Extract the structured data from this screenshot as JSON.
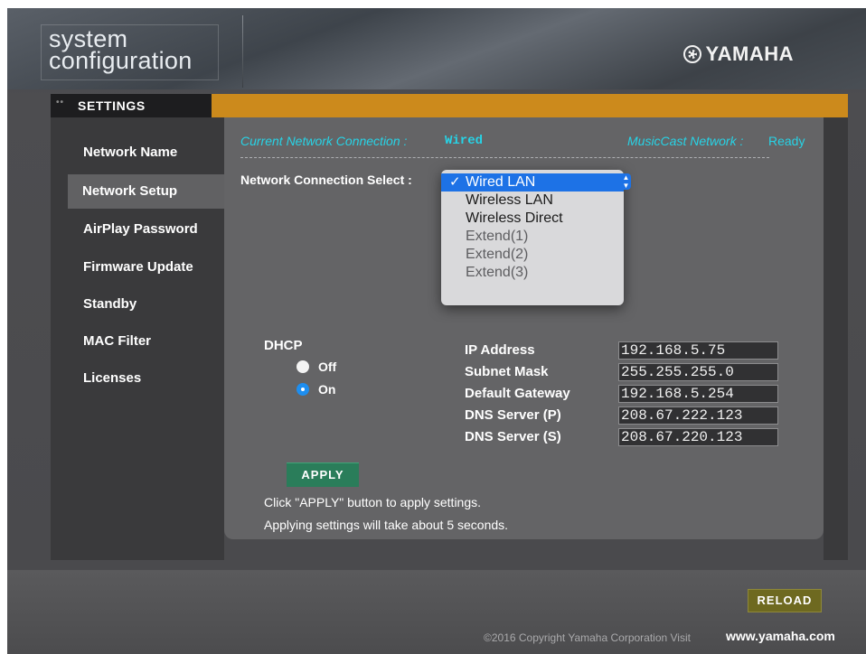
{
  "header": {
    "logo_line1": "system",
    "logo_line2": "configuration",
    "brand": "YAMAHA",
    "brand_icon": "tuning-fork-emblem-icon"
  },
  "settings_tab": {
    "dots": "••",
    "label": "SETTINGS"
  },
  "sidebar": {
    "items": [
      {
        "label": "Network Name",
        "active": false
      },
      {
        "label": "Network Setup",
        "active": true
      },
      {
        "label": "AirPlay Password",
        "active": false
      },
      {
        "label": "Firmware Update",
        "active": false
      },
      {
        "label": "Standby",
        "active": false
      },
      {
        "label": "MAC Filter",
        "active": false
      },
      {
        "label": "Licenses",
        "active": false
      }
    ]
  },
  "status": {
    "current_connection_label": "Current Network Connection :",
    "current_connection_value": "Wired",
    "musiccast_label": "MusicCast Network :",
    "musiccast_value": "Ready",
    "accent_color": "#27d3e6"
  },
  "connection_select": {
    "label": "Network Connection Select :",
    "selected": "Wired LAN",
    "options": [
      {
        "label": "Wired LAN",
        "selected": true,
        "enabled": true
      },
      {
        "label": "Wireless LAN",
        "selected": false,
        "enabled": true
      },
      {
        "label": "Wireless Direct",
        "selected": false,
        "enabled": true
      },
      {
        "label": "Extend(1)",
        "selected": false,
        "enabled": false
      },
      {
        "label": "Extend(2)",
        "selected": false,
        "enabled": false
      },
      {
        "label": "Extend(3)",
        "selected": false,
        "enabled": false
      }
    ]
  },
  "dhcp": {
    "label": "DHCP",
    "off_label": "Off",
    "on_label": "On",
    "value": "On"
  },
  "network_fields": {
    "ip_label": "IP Address",
    "ip_value": "192.168.5.75",
    "subnet_label": "Subnet Mask",
    "subnet_value": "255.255.255.0",
    "gateway_label": "Default Gateway",
    "gateway_value": "192.168.5.254",
    "dns_p_label": "DNS Server (P)",
    "dns_p_value": "208.67.222.123",
    "dns_s_label": "DNS Server (S)",
    "dns_s_value": "208.67.220.123"
  },
  "apply": {
    "button_label": "APPLY",
    "note_line1": "Click \"APPLY\" button to apply settings.",
    "note_line2": "Applying settings will take about 5 seconds."
  },
  "footer": {
    "reload_label": "RELOAD",
    "copyright": "©2016 Copyright Yamaha Corporation Visit",
    "site_link": "www.yamaha.com"
  }
}
